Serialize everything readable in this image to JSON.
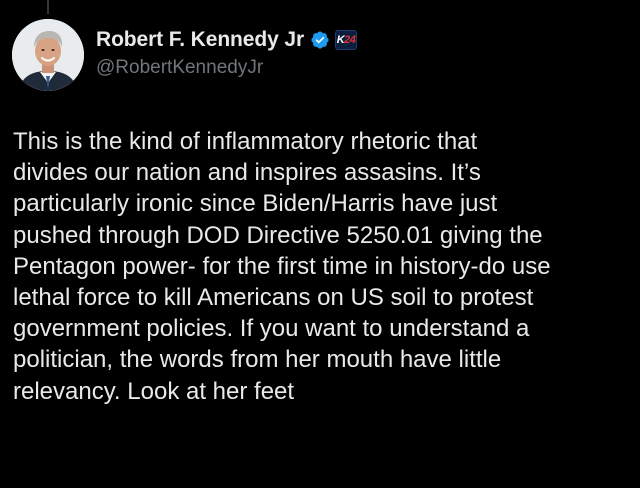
{
  "author": {
    "display_name": "Robert F. Kennedy Jr",
    "handle": "@RobertKennedyJr",
    "verified_icon": "verified-checkmark-icon",
    "affiliate_badge": {
      "icon": "k24-affiliate-badge-icon",
      "label_main": "K",
      "label_accent": "24"
    },
    "avatar": "profile-photo"
  },
  "tweet": {
    "lines": [
      "This is the kind of inflammatory rhetoric that",
      "divides our nation and inspires assasins. It’s",
      "particularly ironic since Biden/Harris have just",
      "pushed through DOD Directive 5250.01 giving the",
      "Pentagon power- for the first time in history-do use",
      "lethal force to kill Americans on US soil to protest",
      "government policies. If you want to understand a",
      "politician, the words from her mouth have little",
      "relevancy. Look at her feet"
    ]
  },
  "colors": {
    "background": "#000000",
    "text_primary": "#e7e9ea",
    "text_secondary": "#71767b",
    "verified_blue": "#1d9bf0",
    "badge_red": "#e0322f"
  }
}
